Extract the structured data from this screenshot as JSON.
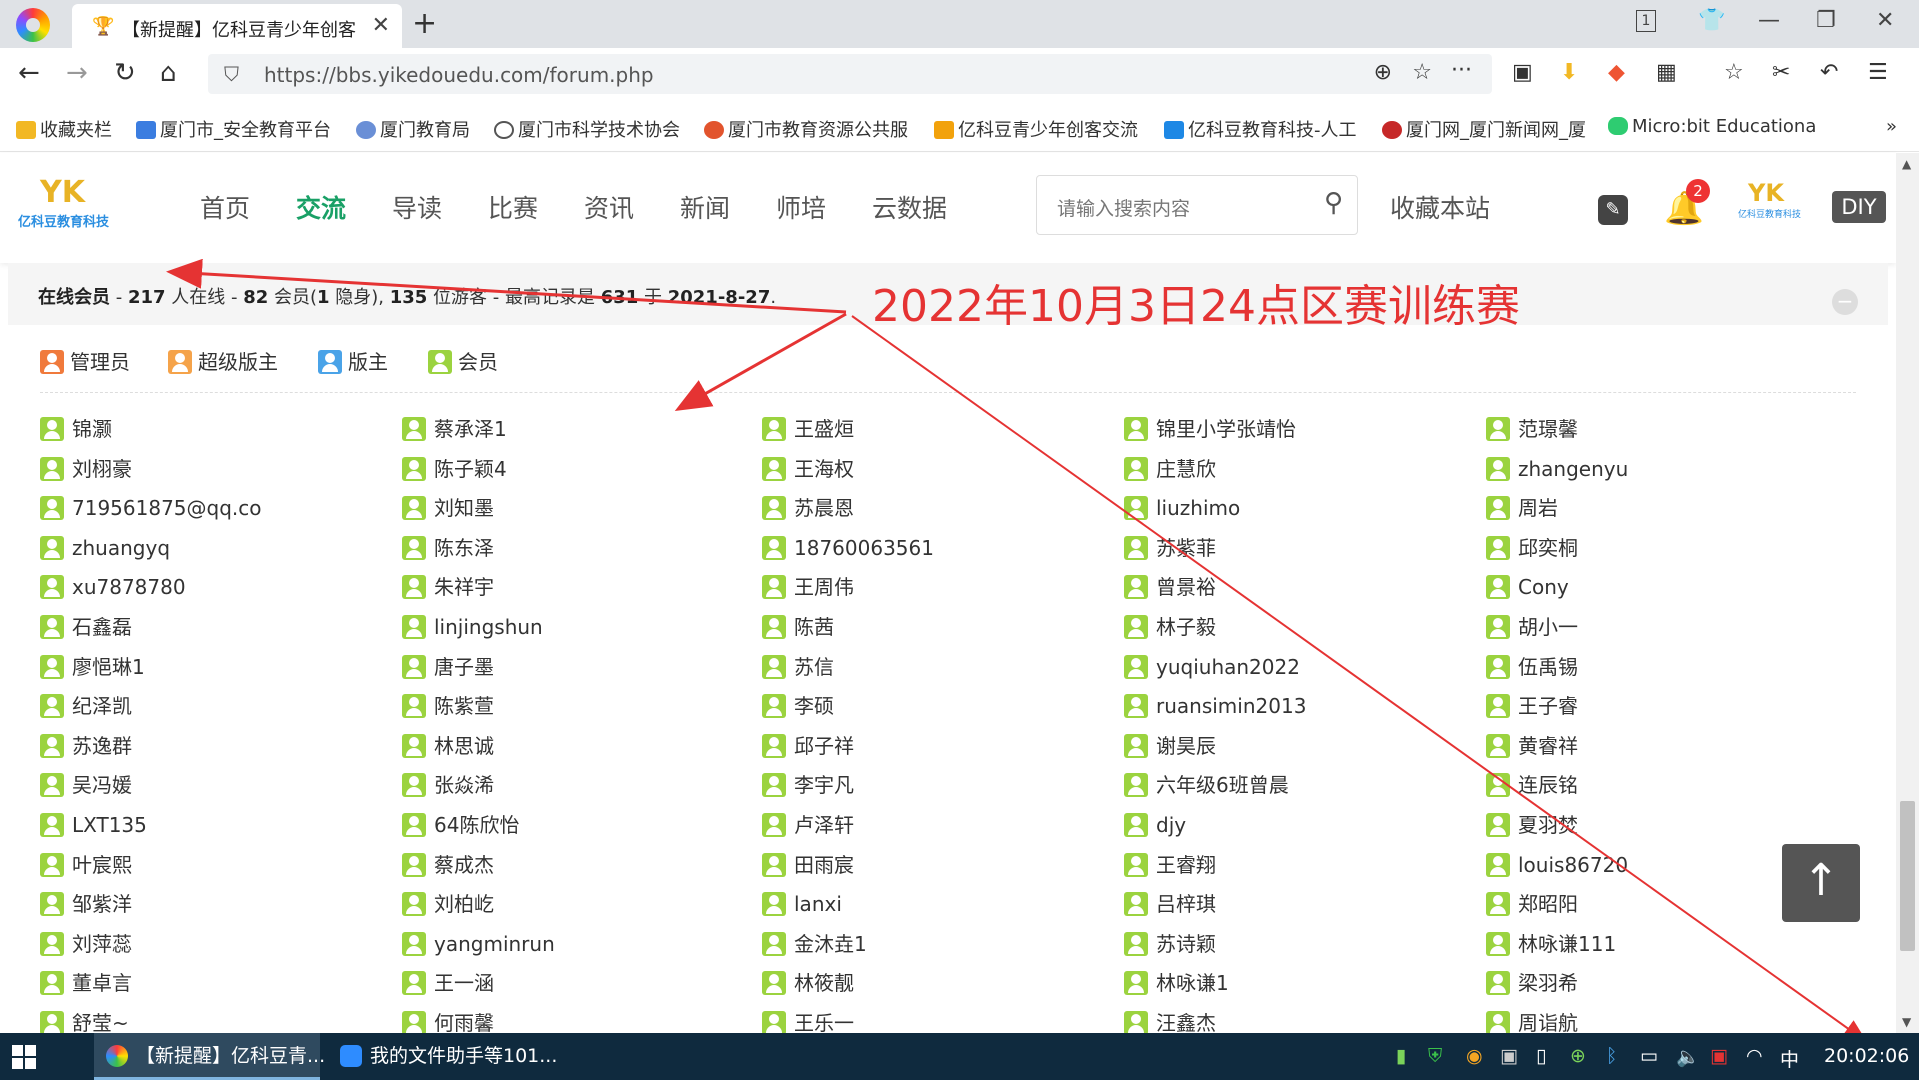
{
  "browser": {
    "tab_title": "【新提醒】亿科豆青少年创客",
    "new_tab_symbol": "+",
    "url": "https://bbs.yikedouedu.com/forum.php",
    "tab_count": "1"
  },
  "bookmarks": [
    {
      "label": "收藏夹栏",
      "color": "#f2b824"
    },
    {
      "label": "厦门市_安全教育平台",
      "color": "#3b7de0"
    },
    {
      "label": "厦门教育局",
      "color": "#6a8fd6"
    },
    {
      "label": "厦门市科学技术协会",
      "color": "#555555"
    },
    {
      "label": "厦门市教育资源公共服",
      "color": "#e2542d"
    },
    {
      "label": "亿科豆青少年创客交流",
      "color": "#f2a20c"
    },
    {
      "label": "亿科豆教育科技-人工",
      "color": "#1e88e5"
    },
    {
      "label": "厦门网_厦门新闻网_厦",
      "color": "#c62828"
    },
    {
      "label": "Micro:bit Educationa",
      "color": "#2ecc71"
    }
  ],
  "site": {
    "logo_text": "YK",
    "logo_name": "亿科豆教育科技",
    "menu": [
      "首页",
      "交流",
      "导读",
      "比赛",
      "资讯",
      "新闻",
      "师培",
      "云数据"
    ],
    "active_menu": "交流",
    "search_placeholder": "请输入搜索内容",
    "bookmark_label": "收藏本站",
    "notification_count": "2",
    "diy_label": "DIY"
  },
  "online": {
    "label": "在线会员",
    "total": "217",
    "t1": " 人在线 - ",
    "members": "82",
    "t2": " 会员(",
    "hidden": "1",
    "t3": " 隐身), ",
    "guests": "135",
    "t4": " 位游客 - 最高记录是 ",
    "record": "631",
    "t5": " 于 ",
    "record_date": "2021-8-27",
    "t6": "."
  },
  "legend": [
    {
      "label": "管理员",
      "color": "#f07a3c"
    },
    {
      "label": "超级版主",
      "color": "#f5a34a"
    },
    {
      "label": "版主",
      "color": "#4aa3e8"
    },
    {
      "label": "会员",
      "color": "#9bd33f"
    }
  ],
  "annotation": "2022年10月3日24点区赛训练赛",
  "members": [
    [
      "锦灏",
      "蔡承泽1",
      "王盛烜",
      "锦里小学张靖怡",
      "范璟馨"
    ],
    [
      "刘栩豪",
      "陈子颖4",
      "王海权",
      "庄慧欣",
      "zhangenyu"
    ],
    [
      "719561875@qq.co",
      "刘知墨",
      "苏晨恩",
      "liuzhimo",
      "周岩"
    ],
    [
      "zhuangyq",
      "陈东泽",
      "18760063561",
      "苏紫菲",
      "邱奕桐"
    ],
    [
      "xu7878780",
      "朱祥宇",
      "王周伟",
      "曾景裕",
      "Cony"
    ],
    [
      "石鑫磊",
      "linjingshun",
      "陈茜",
      "林子毅",
      "胡小一"
    ],
    [
      "廖悒琳1",
      "唐子墨",
      "苏信",
      "yuqiuhan2022",
      "伍禹锡"
    ],
    [
      "纪泽凯",
      "陈紫萱",
      "李硕",
      "ruansimin2013",
      "王子睿"
    ],
    [
      "苏逸群",
      "林思诚",
      "邱子祥",
      "谢昊辰",
      "黄睿祥"
    ],
    [
      "吴冯媛",
      "张焱浠",
      "李宇凡",
      "六年级6班曾晨",
      "连辰铭"
    ],
    [
      "LXT135",
      "64陈欣怡",
      "卢泽轩",
      "djy",
      "夏羽焚"
    ],
    [
      "叶宸熙",
      "蔡成杰",
      "田雨宸",
      "王睿翔",
      "louis86720"
    ],
    [
      "邹紫洋",
      "刘柏屹",
      "lanxi",
      "吕梓琪",
      "郑昭阳"
    ],
    [
      "刘萍蕊",
      "yangminrun",
      "金沐垚1",
      "苏诗颖",
      "林咏谦111"
    ],
    [
      "董卓言",
      "王一涵",
      "林筱靓",
      "林咏谦1",
      "梁羽希"
    ],
    [
      "舒莹~",
      "何雨馨",
      "王乐一",
      "汪鑫杰",
      "周诣航"
    ]
  ],
  "taskbar": {
    "items": [
      {
        "label": "【新提醒】亿科豆青...",
        "color": "#ff7b2e"
      },
      {
        "label": "我的文件助手等101...",
        "color": "#2e8cff"
      }
    ],
    "ime": "中",
    "time": "20:02:06"
  }
}
